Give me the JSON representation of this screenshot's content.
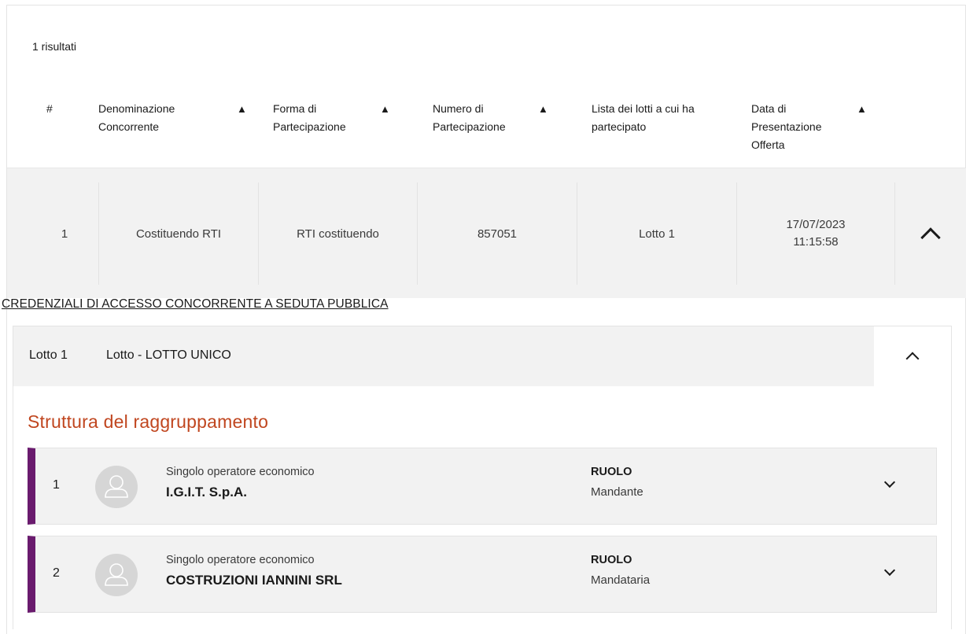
{
  "results": {
    "count_label": "1 risultati"
  },
  "table": {
    "columns": [
      {
        "label": "#",
        "sortable": false
      },
      {
        "label": "Denominazione Concorrente",
        "sortable": true
      },
      {
        "label": "Forma di Partecipazione",
        "sortable": true
      },
      {
        "label": "Numero di Partecipazione",
        "sortable": true
      },
      {
        "label": "Lista dei lotti a cui ha partecipato",
        "sortable": false
      },
      {
        "label": "Data di Presentazione Offerta",
        "sortable": true
      }
    ],
    "sort_icon": "▲",
    "rows": [
      {
        "index": "1",
        "denominazione": "Costituendo RTI",
        "forma": "RTI costituendo",
        "numero": "857051",
        "lotti": "Lotto 1",
        "data": "17/07/2023",
        "ora": "11:15:58",
        "expanded": true
      }
    ]
  },
  "credentials_link": "CREDENZIALI DI ACCESSO CONCORRENTE A SEDUTA PUBBLICA",
  "lotto": {
    "number": "Lotto 1",
    "name": "Lotto - LOTTO UNICO",
    "expanded": true
  },
  "section_title": "Struttura del raggruppamento",
  "members": [
    {
      "index": "1",
      "type": "Singolo operatore economico",
      "name": "I.G.I.T. S.p.A.",
      "role_label": "RUOLO",
      "role": "Mandante"
    },
    {
      "index": "2",
      "type": "Singolo operatore economico",
      "name": "COSTRUZIONI IANNINI SRL",
      "role_label": "RUOLO",
      "role": "Mandataria"
    }
  ],
  "colors": {
    "accent_title": "#c0461f",
    "member_bar": "#6a1b6e",
    "row_bg": "#f2f2f2"
  },
  "icons": {
    "sort": "sort-ascending-icon",
    "expand": "chevron-up-icon",
    "collapse": "chevron-down-icon",
    "avatar": "user-avatar-icon"
  }
}
